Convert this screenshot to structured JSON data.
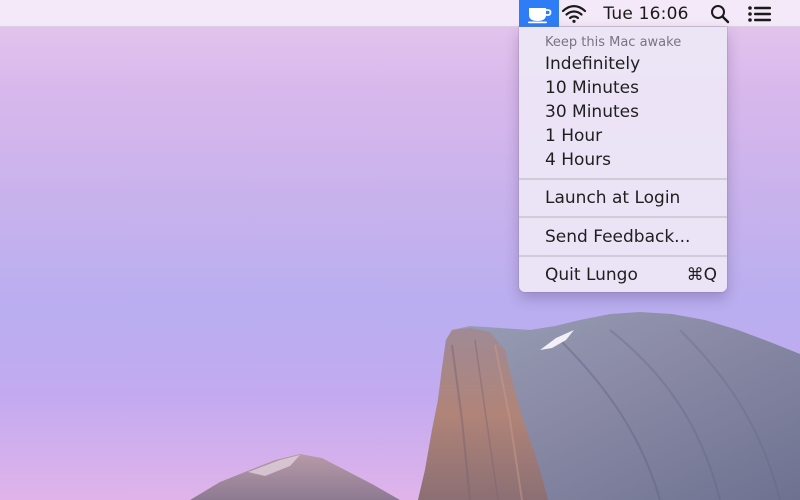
{
  "menubar": {
    "clock": "Tue 16:06",
    "icons": [
      "cup-icon",
      "wifi-icon",
      "search-icon",
      "list-icon"
    ],
    "active_color": "#2f7df6"
  },
  "menu": {
    "header": "Keep this Mac awake",
    "durations": [
      "Indefinitely",
      "10 Minutes",
      "30 Minutes",
      "1 Hour",
      "4 Hours"
    ],
    "launch_at_login": "Launch at Login",
    "send_feedback": "Send Feedback...",
    "quit": "Quit Lungo",
    "quit_shortcut": "⌘Q"
  }
}
